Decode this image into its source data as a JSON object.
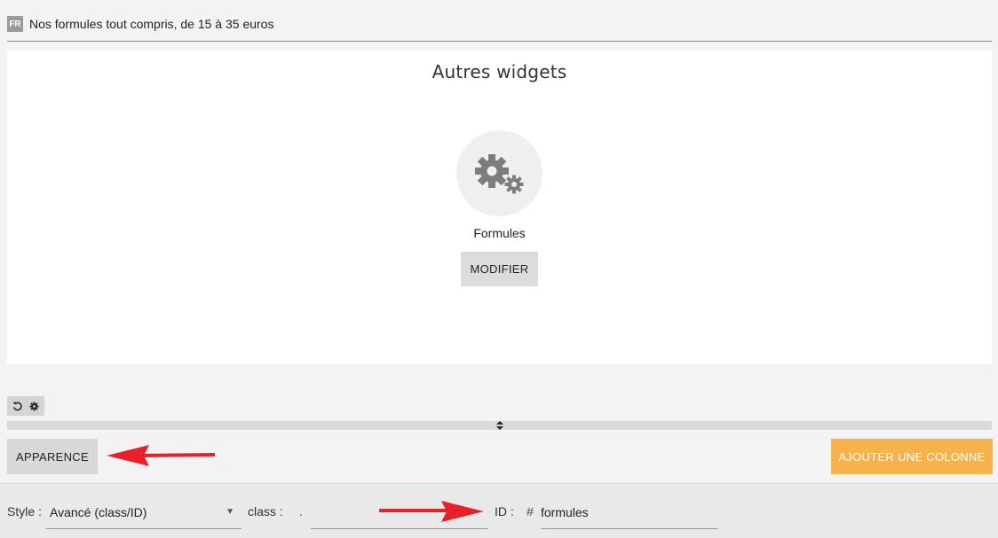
{
  "header": {
    "lang_badge": "FR",
    "title": "Nos formules tout compris, de 15 à 35 euros"
  },
  "widget": {
    "heading": "Autres widgets",
    "name": "Formules",
    "modify_label": "MODIFIER",
    "icon": "gears-icon"
  },
  "toolbar": {
    "undo_icon": "undo-icon",
    "settings_icon": "gear-icon"
  },
  "actions": {
    "apparence_label": "APPARENCE",
    "add_column_label": "AJOUTER UNE COLONNE"
  },
  "style_bar": {
    "style_label": "Style :",
    "style_value": "Avancé (class/ID)",
    "class_label": "class :",
    "class_prefix": ".",
    "class_value": "",
    "id_label": "ID :",
    "id_prefix": "#",
    "id_value": "formules"
  },
  "colors": {
    "accent": "#f8b24c",
    "arrow": "#e8202a"
  }
}
